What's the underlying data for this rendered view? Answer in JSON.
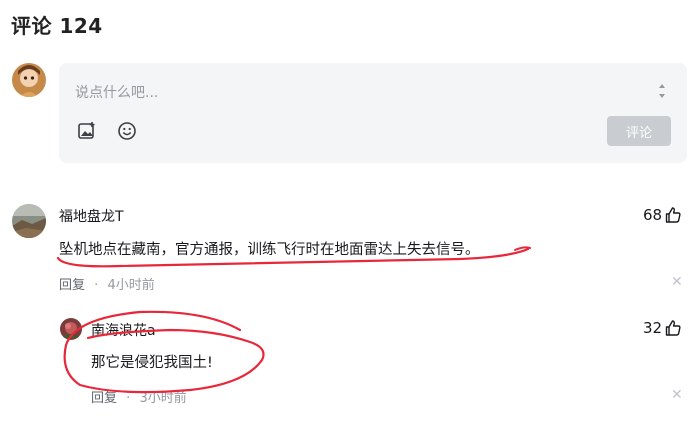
{
  "header": {
    "title": "评论 124"
  },
  "composer": {
    "placeholder": "说点什么吧...",
    "image_icon": "image-add-icon",
    "emoji_icon": "emoji-icon",
    "submit_label": "评论"
  },
  "comments": [
    {
      "username": "福地盘龙T",
      "text": "坠机地点在藏南，官方通报，训练飞行时在地面雷达上失去信号。",
      "likes": "68",
      "reply_label": "回复",
      "time": "4小时前"
    }
  ],
  "replies": [
    {
      "username": "南海浪花a",
      "text": "那它是侵犯我国土!",
      "likes": "32",
      "reply_label": "回复",
      "time": "3小时前"
    }
  ],
  "annotation_color": "#e8283a"
}
